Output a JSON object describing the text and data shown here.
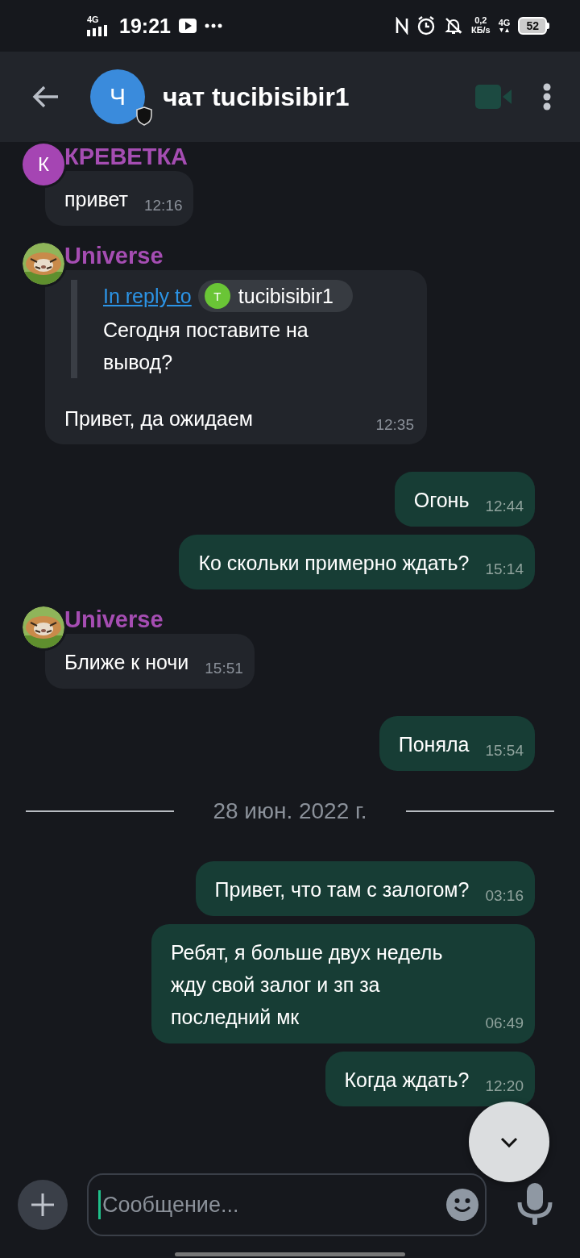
{
  "status_bar": {
    "network": "4G",
    "time": "19:21",
    "speed": "0,2",
    "speed_unit": "КБ/s",
    "data_network": "4G",
    "battery": "52"
  },
  "header": {
    "avatar_initial": "Ч",
    "title": "чат tucibisibir1"
  },
  "messages": [
    {
      "kind": "sender",
      "name": "КРЕВЕТКА",
      "avatar": {
        "kind": "letter",
        "initial": "К",
        "color": "#a545b3"
      }
    },
    {
      "kind": "incoming",
      "text": "привет",
      "time": "12:16"
    },
    {
      "kind": "sender",
      "name": "Universe"
    },
    {
      "kind": "incoming",
      "reply": {
        "label": "In reply to",
        "user_initial": "T",
        "user": "tucibisibir1",
        "text": "Сегодня поставите на вывод?"
      },
      "text": "Привет, да ожидаем",
      "time": "12:35"
    },
    {
      "kind": "outgoing",
      "text": "Огонь",
      "time": "12:44"
    },
    {
      "kind": "outgoing",
      "text": "Ко скольки примерно ждать?",
      "time": "15:14"
    },
    {
      "kind": "sender",
      "name": "Universe"
    },
    {
      "kind": "incoming",
      "text": "Ближе к ночи",
      "time": "15:51"
    },
    {
      "kind": "outgoing",
      "text": "Поняла",
      "time": "15:54"
    },
    {
      "kind": "date",
      "text": "28 июн. 2022 г."
    },
    {
      "kind": "outgoing",
      "text": "Привет, что там с залогом?",
      "time": "03:16"
    },
    {
      "kind": "outgoing",
      "text": "Ребят, я больше двух недель жду свой залог и зп за последний мк",
      "time": "06:49"
    },
    {
      "kind": "outgoing",
      "text": "Когда ждать?",
      "time": "12:20"
    }
  ],
  "composer": {
    "placeholder": "Сообщение..."
  }
}
